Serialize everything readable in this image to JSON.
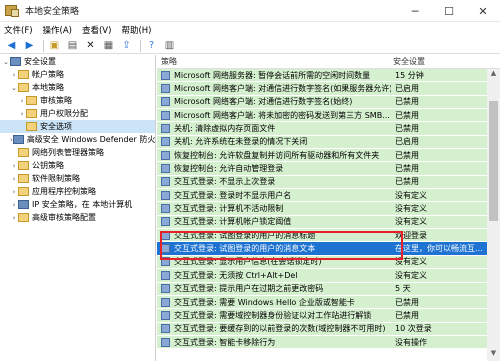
{
  "window": {
    "title": "本地安全策略",
    "minimize_icon": "minimize-icon",
    "maximize_icon": "maximize-icon",
    "close_icon": "close-icon"
  },
  "menu": [
    "文件(F)",
    "操作(A)",
    "查看(V)",
    "帮助(H)"
  ],
  "toolbar": [
    "back-icon",
    "forward-icon",
    "up-folder-icon",
    "show-tree-icon",
    "delete-icon",
    "properties-icon",
    "export-icon",
    "help-icon",
    "view-icon"
  ],
  "tree": [
    {
      "label": "安全设置",
      "indent": 0,
      "exp": "⌄",
      "icon": "shield-icon"
    },
    {
      "label": "帐户策略",
      "indent": 1,
      "exp": "›",
      "icon": "folder-icon"
    },
    {
      "label": "本地策略",
      "indent": 1,
      "exp": "⌄",
      "icon": "folder-icon"
    },
    {
      "label": "审核策略",
      "indent": 2,
      "exp": "›",
      "icon": "folder-icon"
    },
    {
      "label": "用户权限分配",
      "indent": 2,
      "exp": "›",
      "icon": "folder-icon"
    },
    {
      "label": "安全选项",
      "indent": 2,
      "exp": "",
      "icon": "folder-icon",
      "selected": true
    },
    {
      "label": "高级安全 Windows Defender 防火墙",
      "indent": 1,
      "exp": "›",
      "icon": "shield-icon"
    },
    {
      "label": "网络列表管理器策略",
      "indent": 1,
      "exp": "",
      "icon": "folder-icon"
    },
    {
      "label": "公钥策略",
      "indent": 1,
      "exp": "›",
      "icon": "folder-icon"
    },
    {
      "label": "软件限制策略",
      "indent": 1,
      "exp": "›",
      "icon": "folder-icon"
    },
    {
      "label": "应用程序控制策略",
      "indent": 1,
      "exp": "›",
      "icon": "folder-icon"
    },
    {
      "label": "IP 安全策略，在 本地计算机",
      "indent": 1,
      "exp": "›",
      "icon": "shield-icon"
    },
    {
      "label": "高级审核策略配置",
      "indent": 1,
      "exp": "›",
      "icon": "folder-icon"
    }
  ],
  "columns": {
    "policy": "策略",
    "setting": "安全设置"
  },
  "rows": [
    {
      "policy": "Microsoft 网络服务器: 暂停会话前所需的空闲时间数量",
      "setting": "15 分钟"
    },
    {
      "policy": "Microsoft 网络客户端: 对通信进行数字签名(如果服务器允许)",
      "setting": "已启用"
    },
    {
      "policy": "Microsoft 网络客户端: 对通信进行数字签名(始终)",
      "setting": "已禁用"
    },
    {
      "policy": "Microsoft 网络客户端: 将未加密的密码发送到第三方 SMB...",
      "setting": "已禁用"
    },
    {
      "policy": "关机: 清除虚拟内存页面文件",
      "setting": "已禁用"
    },
    {
      "policy": "关机: 允许系统在未登录的情况下关闭",
      "setting": "已启用"
    },
    {
      "policy": "恢复控制台: 允许软盘复制并访问所有驱动器和所有文件夹",
      "setting": "已禁用"
    },
    {
      "policy": "恢复控制台: 允许自动管理登录",
      "setting": "已禁用"
    },
    {
      "policy": "交互式登录: 不显示上次登录",
      "setting": "已禁用"
    },
    {
      "policy": "交互式登录: 登录时不显示用户名",
      "setting": "没有定义"
    },
    {
      "policy": "交互式登录: 计算机不活动限制",
      "setting": "没有定义"
    },
    {
      "policy": "交互式登录: 计算机帐户锁定阈值",
      "setting": "没有定义"
    },
    {
      "policy": "交互式登录: 试图登录的用户的消息标题",
      "setting": "欢迎登录"
    },
    {
      "policy": "交互式登录: 试图登录的用户的消息文本",
      "setting": "在这里，你可以畅流互...",
      "selected": true
    },
    {
      "policy": "交互式登录: 显示用户信息(在会话锁定时)",
      "setting": "没有定义"
    },
    {
      "policy": "交互式登录: 无须按 Ctrl+Alt+Del",
      "setting": "没有定义"
    },
    {
      "policy": "交互式登录: 提示用户在过期之前更改密码",
      "setting": "5 天"
    },
    {
      "policy": "交互式登录: 需要 Windows Hello 企业版或智能卡",
      "setting": "已禁用"
    },
    {
      "policy": "交互式登录: 需要域控制器身份验证以对工作站进行解锁",
      "setting": "已禁用"
    },
    {
      "policy": "交互式登录: 要缓存到的以前登录的次数(域控制器不可用时)",
      "setting": "10 次登录"
    },
    {
      "policy": "交互式登录: 智能卡移除行为",
      "setting": "没有操作"
    }
  ]
}
